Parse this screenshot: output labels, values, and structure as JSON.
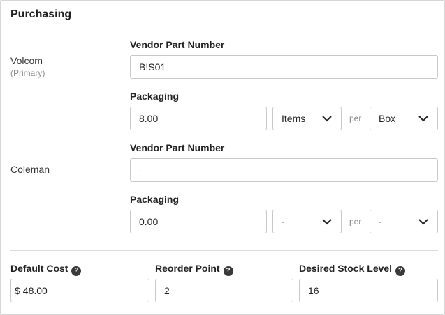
{
  "section_title": "Purchasing",
  "vendors": [
    {
      "name": "Volcom",
      "sub": "(Primary)",
      "part_label": "Vendor Part Number",
      "part_value": "B!S01",
      "packaging_label": "Packaging",
      "packaging_qty": "8.00",
      "unit": "Items",
      "per": "per",
      "container": "Box"
    },
    {
      "name": "Coleman",
      "part_label": "Vendor Part Number",
      "part_value": "-",
      "packaging_label": "Packaging",
      "packaging_qty": "0.00",
      "unit": "-",
      "per": "per",
      "container": "-"
    }
  ],
  "bottom": {
    "default_cost": {
      "label": "Default Cost",
      "prefix": "$",
      "value": "48.00"
    },
    "reorder_point": {
      "label": "Reorder Point",
      "value": "2"
    },
    "desired_stock": {
      "label": "Desired Stock Level",
      "value": "16"
    }
  },
  "icons": {
    "help": "question-circle-icon",
    "chevron": "chevron-down-icon"
  },
  "colors": {
    "border": "#c9c9c9",
    "placeholder": "#b5b5b5",
    "help_icon": "#3a3a3a"
  }
}
